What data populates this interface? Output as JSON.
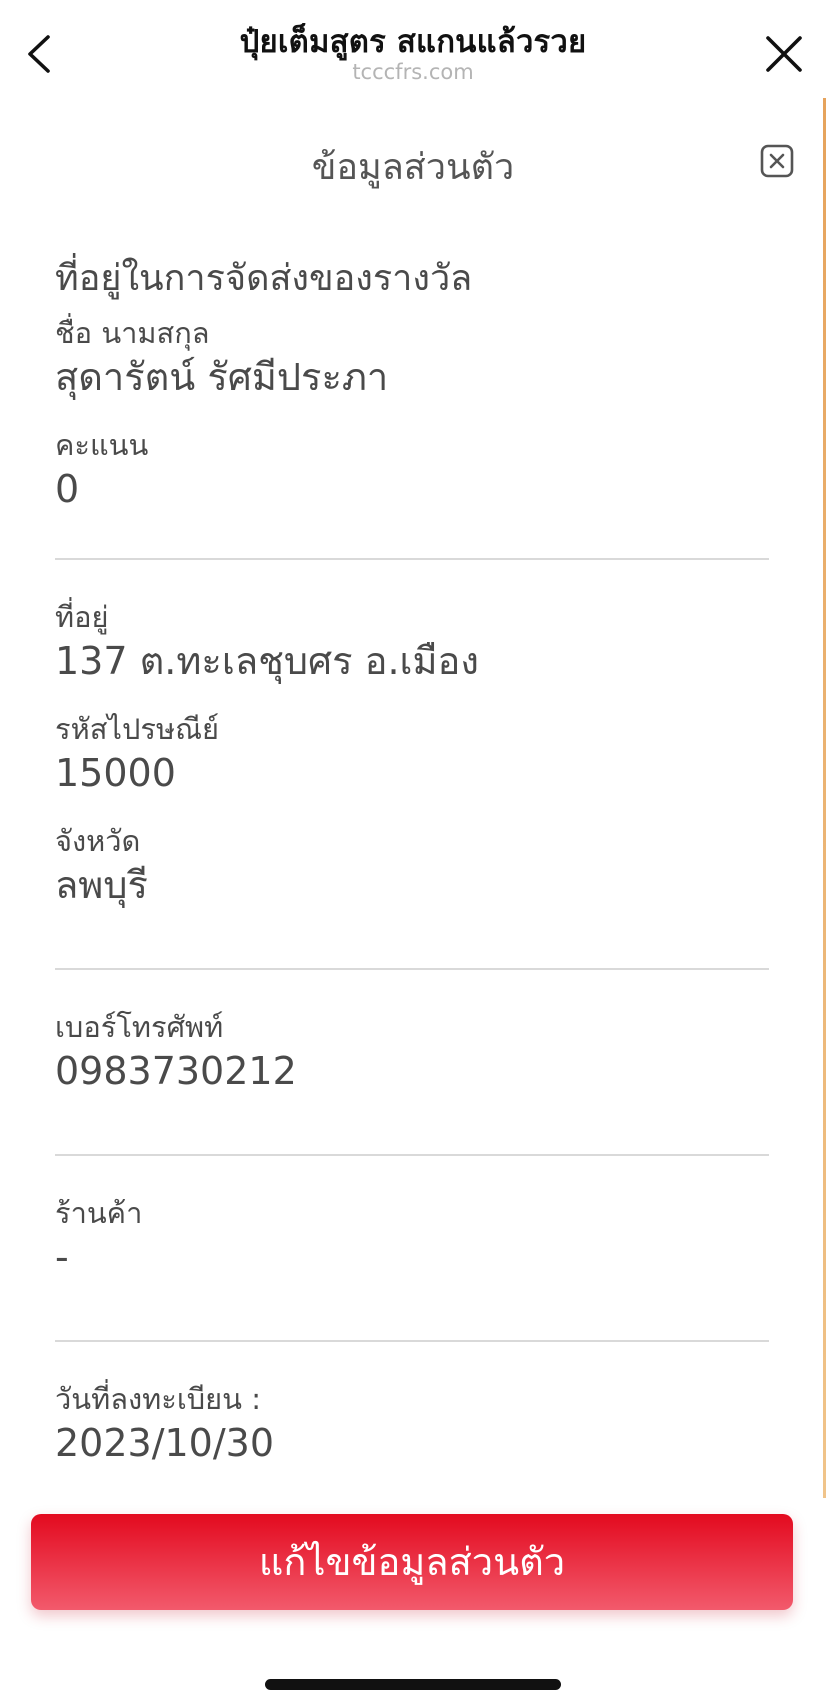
{
  "browser": {
    "title": "ปุ๋ยเต็มสูตร สแกนแล้วรวย",
    "url": "tcccfrs.com"
  },
  "modal": {
    "title": "ข้อมูลส่วนตัว"
  },
  "section": {
    "title": "ที่อยู่ในการจัดส่งของรางวัล"
  },
  "fields": {
    "name": {
      "label": "ชื่อ นามสกุล",
      "value": "สุดารัตน์ รัศมีประภา"
    },
    "points": {
      "label": "คะแนน",
      "value": "0"
    },
    "address": {
      "label": "ที่อยู่",
      "value": "137 ต.ทะเลชุบศร อ.เมือง"
    },
    "postcode": {
      "label": "รหัสไปรษณีย์",
      "value": "15000"
    },
    "province": {
      "label": "จังหวัด",
      "value": "ลพบุรี"
    },
    "phone": {
      "label": "เบอร์โทรศัพท์",
      "value": "0983730212"
    },
    "shop": {
      "label": "ร้านค้า",
      "value": "-"
    },
    "registered": {
      "label": "วันที่ลงทะเบียน :",
      "value": "2023/10/30"
    }
  },
  "actions": {
    "edit_label": "แก้ไขข้อมูลส่วนตัว"
  },
  "icons": {
    "back": "chevron-left-icon",
    "close": "close-icon",
    "modal_close": "close-square-icon"
  },
  "colors": {
    "primary_red": "#e30a1f",
    "text": "#4a4a4a",
    "url_gray": "#b4b4b4",
    "divider": "#d9d9d9"
  }
}
